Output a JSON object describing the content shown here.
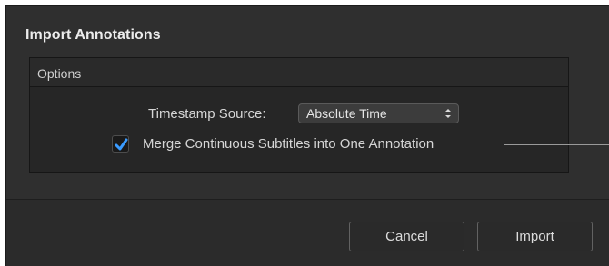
{
  "dialog": {
    "title": "Import Annotations"
  },
  "options": {
    "header": "Options",
    "timestamp_label": "Timestamp Source:",
    "timestamp_value": "Absolute Time",
    "merge_checked": true,
    "merge_label": "Merge Continuous Subtitles into One Annotation"
  },
  "footer": {
    "cancel_label": "Cancel",
    "import_label": "Import"
  },
  "colors": {
    "checkmark": "#3a9bff",
    "background": "#2f2f2f"
  },
  "icons": {
    "popup": "updown-chevron-icon",
    "checkbox": "checkmark-icon"
  }
}
